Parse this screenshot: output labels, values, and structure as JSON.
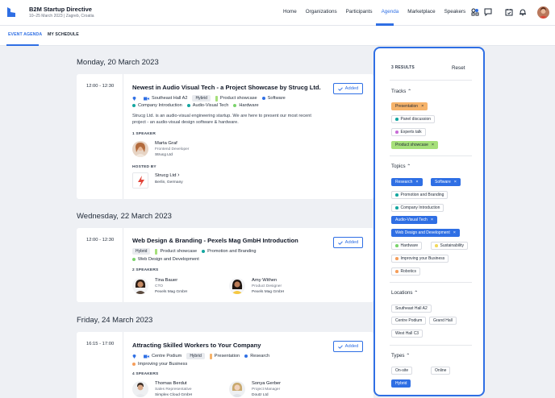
{
  "header": {
    "app_title": "B2M Startup Directive",
    "app_subtitle": "10–25 March 2023 | Zagreb, Croatia",
    "nav": [
      "Home",
      "Organizations",
      "Participants",
      "Agenda",
      "Marketplace",
      "Speakers"
    ],
    "active_nav": "Agenda"
  },
  "subtabs": {
    "event_agenda": "EVENT AGENDA",
    "my_schedule": "MY SCHEDULE"
  },
  "days": [
    {
      "title": "Monday, 20 March 2023",
      "session": {
        "time": "12:00 - 12:30",
        "title": "Newest in Audio Visual Tech - a Project Showcase by Strucg Ltd.",
        "added": "Added",
        "location": "Southeast Hall A2",
        "format": "Hybrid",
        "tags_line1": [
          "Product showcase",
          "Software"
        ],
        "tags_line2": [
          "Company Introduction",
          "Audio-Visual Tech",
          "Hardware"
        ],
        "description": "Strucg Ltd. is an audio-visual engineering startup. We are here to present our most recent project - an audio-visual design software & hardware.",
        "speakers_label": "1 SPEAKER",
        "speakers": [
          {
            "name": "Marta Graf",
            "role": "Frontend Developer",
            "company": "Strucg Ltd"
          }
        ],
        "hosted_label": "HOSTED BY",
        "host": {
          "name": "Strucg Ltd",
          "location": "Berlin, Germany"
        }
      }
    },
    {
      "title": "Wednesday, 22 March 2023",
      "session": {
        "time": "12:00 - 12:30",
        "title": "Web Design & Branding - Pexels Mag GmbH Introduction",
        "added": "Added",
        "format": "Hybrid",
        "tags_line1": [
          "Product showcase",
          "Promotion and Branding"
        ],
        "tags_line2": [
          "Web Design and Development"
        ],
        "speakers_label": "2 SPEAKERS",
        "speakers": [
          {
            "name": "Tina Bauer",
            "role": "CTO",
            "company": "Pexels Mag GmbH"
          },
          {
            "name": "Amy Withen",
            "role": "Product Designer",
            "company": "Pexels Mag GmbH"
          }
        ]
      }
    },
    {
      "title": "Friday, 24 March 2023",
      "session": {
        "time": "16:15 - 17:00",
        "title": "Attracting Skilled Workers to Your Company",
        "added": "Added",
        "location": "Centre Podium",
        "format": "Hybrid",
        "tags_line1": [
          "Presentation",
          "Research"
        ],
        "tags_line2": [
          "Improving your Business"
        ],
        "speakers_label": "4 SPEAKERS",
        "speakers": [
          {
            "name": "Thomas Berdut",
            "role": "Sales Representative",
            "company": "Simplex Cloud GmbH"
          },
          {
            "name": "Sonya Gerber",
            "role": "Project Manager",
            "company": "Doutz Ltd"
          }
        ]
      }
    }
  ],
  "filters": {
    "results": "3 RESULTS",
    "reset": "Reset",
    "tracks_label": "Tracks",
    "tracks": [
      "Presentation",
      "Panel discussion",
      "Experts talk",
      "Product showcase"
    ],
    "topics_label": "Topics",
    "topics": [
      "Research",
      "Software",
      "Promotion and Branding",
      "Company Introduction",
      "Audio-Visual Tech",
      "Web Design and Development",
      "Hardware",
      "Sustainability",
      "Improving your Business",
      "Robotics"
    ],
    "locations_label": "Locations",
    "locations": [
      "Southeast Hall A2",
      "Centre Podium",
      "Grand Hall",
      "West Hall C3"
    ],
    "types_label": "Types",
    "types": [
      "On-site",
      "Online",
      "Hybrid"
    ]
  },
  "colors": {
    "accent": "#2f6fe4",
    "presentation": "#f6b36a",
    "product_showcase": "#a6e07a",
    "research": "#2f6fe4",
    "teal": "#14a6a0",
    "orange": "#f59e5b",
    "green": "#7ad36b",
    "yellow": "#f2d85a"
  }
}
